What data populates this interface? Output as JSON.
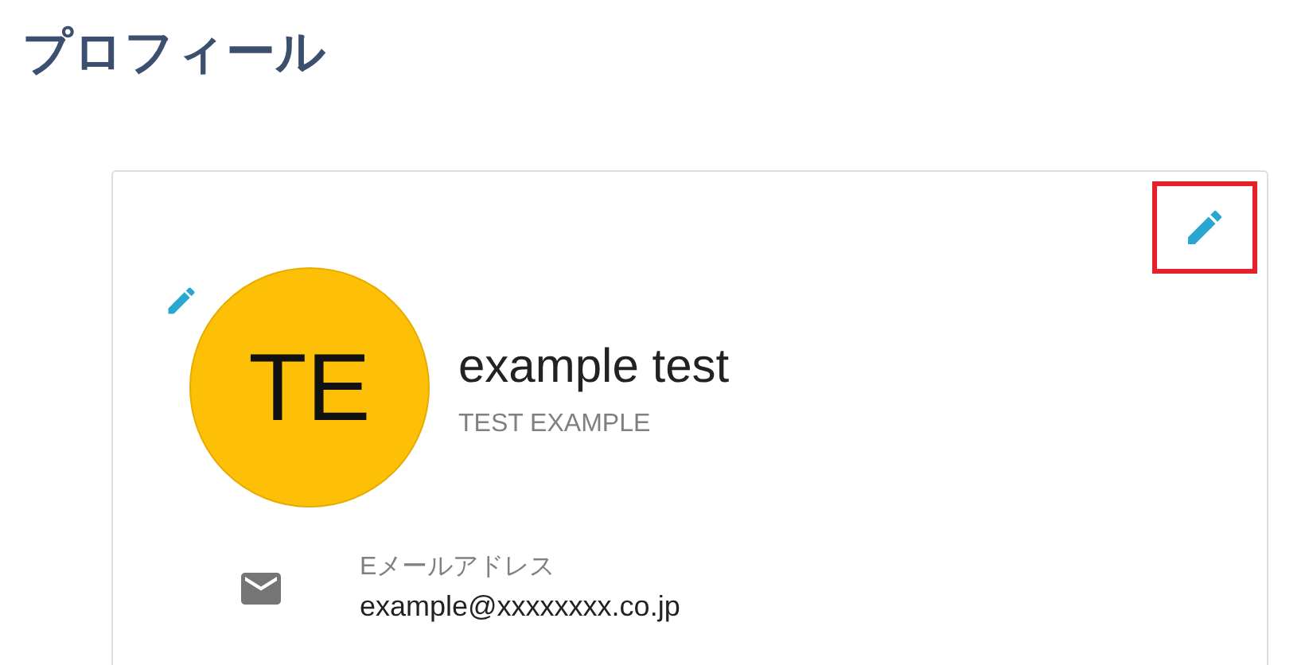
{
  "page_title": "プロフィール",
  "card": {
    "edit_button": {
      "highlighted": true
    },
    "avatar": {
      "initials": "TE",
      "color": "#fdc006"
    },
    "name": "example test",
    "subtitle": "TEST EXAMPLE",
    "fields": [
      {
        "kind": "email",
        "label": "Eメールアドレス",
        "value": "example@xxxxxxxx.co.jp"
      }
    ]
  }
}
